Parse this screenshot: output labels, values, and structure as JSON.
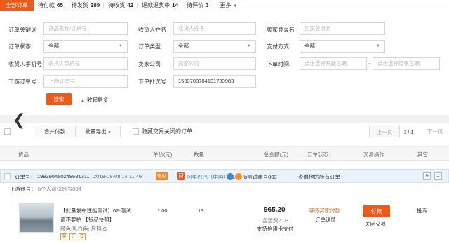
{
  "tabs": [
    {
      "label": "全部订单",
      "count": ""
    },
    {
      "label": "待付款",
      "count": "65"
    },
    {
      "label": "待发货",
      "count": "289"
    },
    {
      "label": "待收货",
      "count": "42"
    },
    {
      "label": "退款退货中",
      "count": "14"
    },
    {
      "label": "待评价",
      "count": "3"
    },
    {
      "label": "更多",
      "count": ""
    }
  ],
  "filters": {
    "order_keyword": {
      "label": "订单关键词",
      "placeholder": "货品名称/订单号"
    },
    "receiver_name": {
      "label": "收货人姓名",
      "placeholder": "收货人姓名"
    },
    "seller_login": {
      "label": "卖家登录名",
      "placeholder": "卖家登录名"
    },
    "order_status": {
      "label": "订单状态",
      "value": "全部"
    },
    "order_type": {
      "label": "订单类型",
      "value": "全部"
    },
    "pay_method": {
      "label": "支付方式",
      "value": "全部"
    },
    "receiver_phone": {
      "label": "收货人手机号",
      "placeholder": "收货人手机号"
    },
    "seller_company": {
      "label": "卖家公司",
      "placeholder": "卖家公司"
    },
    "order_time": {
      "label": "下单时间",
      "start_placeholder": "点击选择开始日期",
      "end_placeholder": "点击选择结束日期",
      "separator": "-"
    },
    "downstream_order": {
      "label": "下游订单号",
      "placeholder": "下游订单号"
    },
    "batch_no": {
      "label": "下单批次号",
      "value": "1533708704131733983"
    },
    "search_label": "搜索",
    "collapse_label": "收起更多"
  },
  "toolbar": {
    "merge_pay": "合并付款",
    "batch_export": "批量导出",
    "hide_closed": "隐藏交易关闭的订单",
    "prev_page": "上一页",
    "page_current": "1",
    "page_sep": "/",
    "page_total": "1",
    "next_page": "下一页"
  },
  "columns": [
    "货品",
    "单价(元)",
    "数量",
    "总金额(元)",
    "订单状态",
    "交易操作",
    "其它"
  ],
  "order": {
    "order_no_label": "订单号：",
    "order_no": "1993964802486813​11",
    "order_time": "2018-08-08 14:11:46",
    "badge": "微供",
    "ali_badge": "阿",
    "seller": "阿里巴巴（中国）网...",
    "buyer_account": "b测试账号003",
    "view_all": "查看他的所有订单",
    "downstream_label": "下游账号：",
    "downstream_value": "b个人测试账号004",
    "item": {
      "title_line1": "【批量发布性能测试】02-测试",
      "title_line2": "请不要拍 【货品快照】",
      "spec": "颜色:乳白色;  尺码:S",
      "price": "1.00",
      "qty": "13",
      "total": "965.20",
      "shipping": "含运费2.03",
      "credit": "支持信用卡支付",
      "status": "等待买家付款",
      "detail": "订单详情",
      "pay": "付款",
      "close": "关闭交易",
      "complaint": "投诉",
      "mini_icons": [
        "保",
        "7",
        "支"
      ]
    }
  },
  "colors": {
    "accent": "#f05a18",
    "status": "#e07010",
    "link": "#3a6fb0"
  }
}
